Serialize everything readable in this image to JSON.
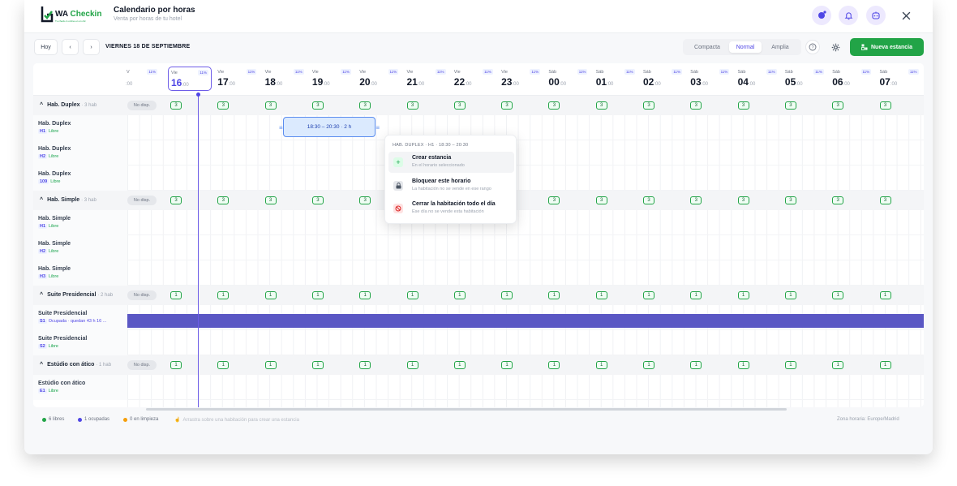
{
  "header": {
    "logo_text_a": "WA",
    "logo_text_b": "Checkin",
    "logo_sub": "Tu check-in online en un clic",
    "title": "Calendario por horas",
    "subtitle": "Venta por horas de tu hotel"
  },
  "toolbar": {
    "today_label": "Hoy",
    "prev_label": "‹",
    "next_label": "›",
    "date_label": "VIERNES 18 DE SEPTIEMBRE",
    "view_compact": "Compacta",
    "view_normal": "Normal",
    "view_wide": "Amplia",
    "new_stay_label": "Nueva estancia"
  },
  "hours": [
    {
      "day": "Vie",
      "hour": "16",
      "pct": "11%"
    },
    {
      "day": "Vie",
      "hour": "17",
      "pct": "11%"
    },
    {
      "day": "Vie",
      "hour": "18",
      "pct": "11%"
    },
    {
      "day": "Vie",
      "hour": "19",
      "pct": "11%"
    },
    {
      "day": "Vie",
      "hour": "20",
      "pct": "11%"
    },
    {
      "day": "Vie",
      "hour": "21",
      "pct": "11%"
    },
    {
      "day": "Vie",
      "hour": "22",
      "pct": "11%"
    },
    {
      "day": "Vie",
      "hour": "23",
      "pct": "11%"
    },
    {
      "day": "Sáb",
      "hour": "00",
      "pct": "11%"
    },
    {
      "day": "Sáb",
      "hour": "01",
      "pct": "11%"
    },
    {
      "day": "Sáb",
      "hour": "02",
      "pct": "11%"
    },
    {
      "day": "Sáb",
      "hour": "03",
      "pct": "11%"
    },
    {
      "day": "Sáb",
      "hour": "04",
      "pct": "11%"
    },
    {
      "day": "Sáb",
      "hour": "05",
      "pct": "11%"
    },
    {
      "day": "Sáb",
      "hour": "06",
      "pct": "11%"
    },
    {
      "day": "Sáb",
      "hour": "07",
      "pct": "11%"
    }
  ],
  "minutes_suffix": ":00",
  "partial_hour": {
    "text": ":00",
    "pct": "11%",
    "day": "V"
  },
  "groups": [
    {
      "name": "Hab. Duplex",
      "count": "· 3 hab",
      "nodisp": "No disp.",
      "avail": "3",
      "rooms": [
        {
          "name": "Hab. Duplex",
          "code": "H1",
          "status": "Libre"
        },
        {
          "name": "Hab. Duplex",
          "code": "H2",
          "status": "Libre"
        },
        {
          "name": "Hab. Duplex",
          "code": "109",
          "status": "Libre"
        }
      ]
    },
    {
      "name": "Hab. Simple",
      "count": "· 3 hab",
      "nodisp": "No disp.",
      "avail": "3",
      "rooms": [
        {
          "name": "Hab. Simple",
          "code": "H1",
          "status": "Libre"
        },
        {
          "name": "Hab. Simple",
          "code": "H2",
          "status": "Libre"
        },
        {
          "name": "Hab. Simple",
          "code": "H3",
          "status": "Libre"
        }
      ]
    },
    {
      "name": "Suite Presidencial",
      "count": "· 2 hab",
      "nodisp": "No disp.",
      "avail": "1",
      "rooms": [
        {
          "name": "Suite Presidencial",
          "code": "S1",
          "status": "Ocupada · quedan 43 h 16 ..."
        },
        {
          "name": "Suite Presidencial",
          "code": "S2",
          "status": "Libre"
        }
      ]
    },
    {
      "name": "Estúdio con ático",
      "count": "· 1 hab",
      "nodisp": "No disp.",
      "avail": "1",
      "rooms": [
        {
          "name": "Estúdio con ático",
          "code": "E1",
          "status": "Libre"
        }
      ]
    }
  ],
  "selection": {
    "label": "18:30 – 20:30 · 2 h"
  },
  "popup": {
    "header": "HAB. DUPLEX · H1 · 18:30 – 20:30",
    "items": [
      {
        "title": "Crear estancia",
        "sub": "En el horario seleccionado"
      },
      {
        "title": "Bloquear este horario",
        "sub": "La habitación no se vende en ese rango"
      },
      {
        "title": "Cerrar la habitación todo el día",
        "sub": "Ese día no se vende esta habitación"
      }
    ]
  },
  "footer": {
    "free": "6 libres",
    "occupied": "1 ocupadas",
    "cleaning": "0 en limpieza",
    "hint": "Arrastra sobre una habitación para crear una estancia",
    "timezone": "Zona horaria: Europe/Madrid"
  },
  "colors": {
    "accent": "#4f46e5",
    "brand": "#22a447",
    "occupied": "#5a57c4",
    "selection": "#dbeafe"
  }
}
